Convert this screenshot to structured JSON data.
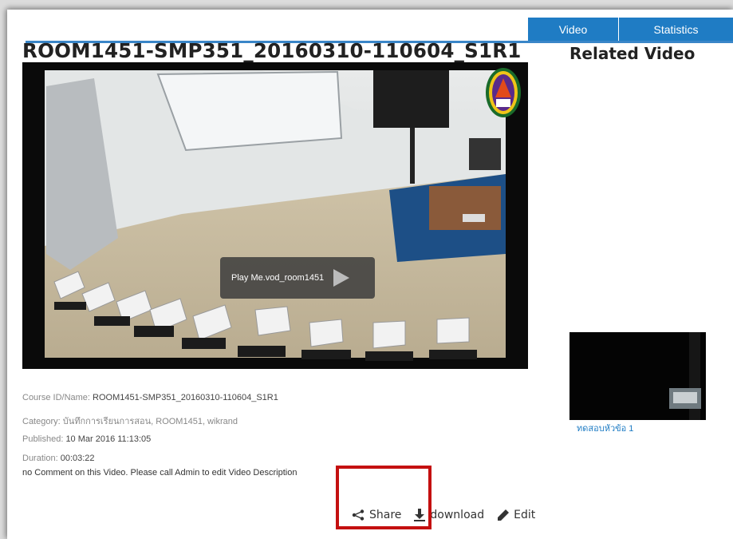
{
  "tabs": {
    "video": "Video",
    "statistics": "Statistics"
  },
  "video": {
    "title": "ROOM1451-SMP351_20160310-110604_S1R1",
    "play_label": "Play Me.vod_room1451"
  },
  "details": {
    "course_label": "Course ID/Name:",
    "course_value": "ROOM1451-SMP351_20160310-110604_S1R1",
    "category_label": "Category:",
    "category_value": "บันทึกการเรียนการสอน, ROOM1451, wikrand",
    "published_label": "Published:",
    "published_value": "10 Mar 2016 11:13:05",
    "duration_label": "Duration:",
    "duration_value": "00:03:22",
    "comment": "no Comment on this Video. Please call Admin to edit Video Description"
  },
  "actions": {
    "share": "Share",
    "download": "download",
    "edit": "Edit"
  },
  "related": {
    "heading": "Related Video",
    "items": [
      {
        "caption": "ทดสอบหัวข้อ 1"
      }
    ]
  },
  "colors": {
    "accent": "#1f7cc4",
    "highlight_box": "#c41010"
  }
}
